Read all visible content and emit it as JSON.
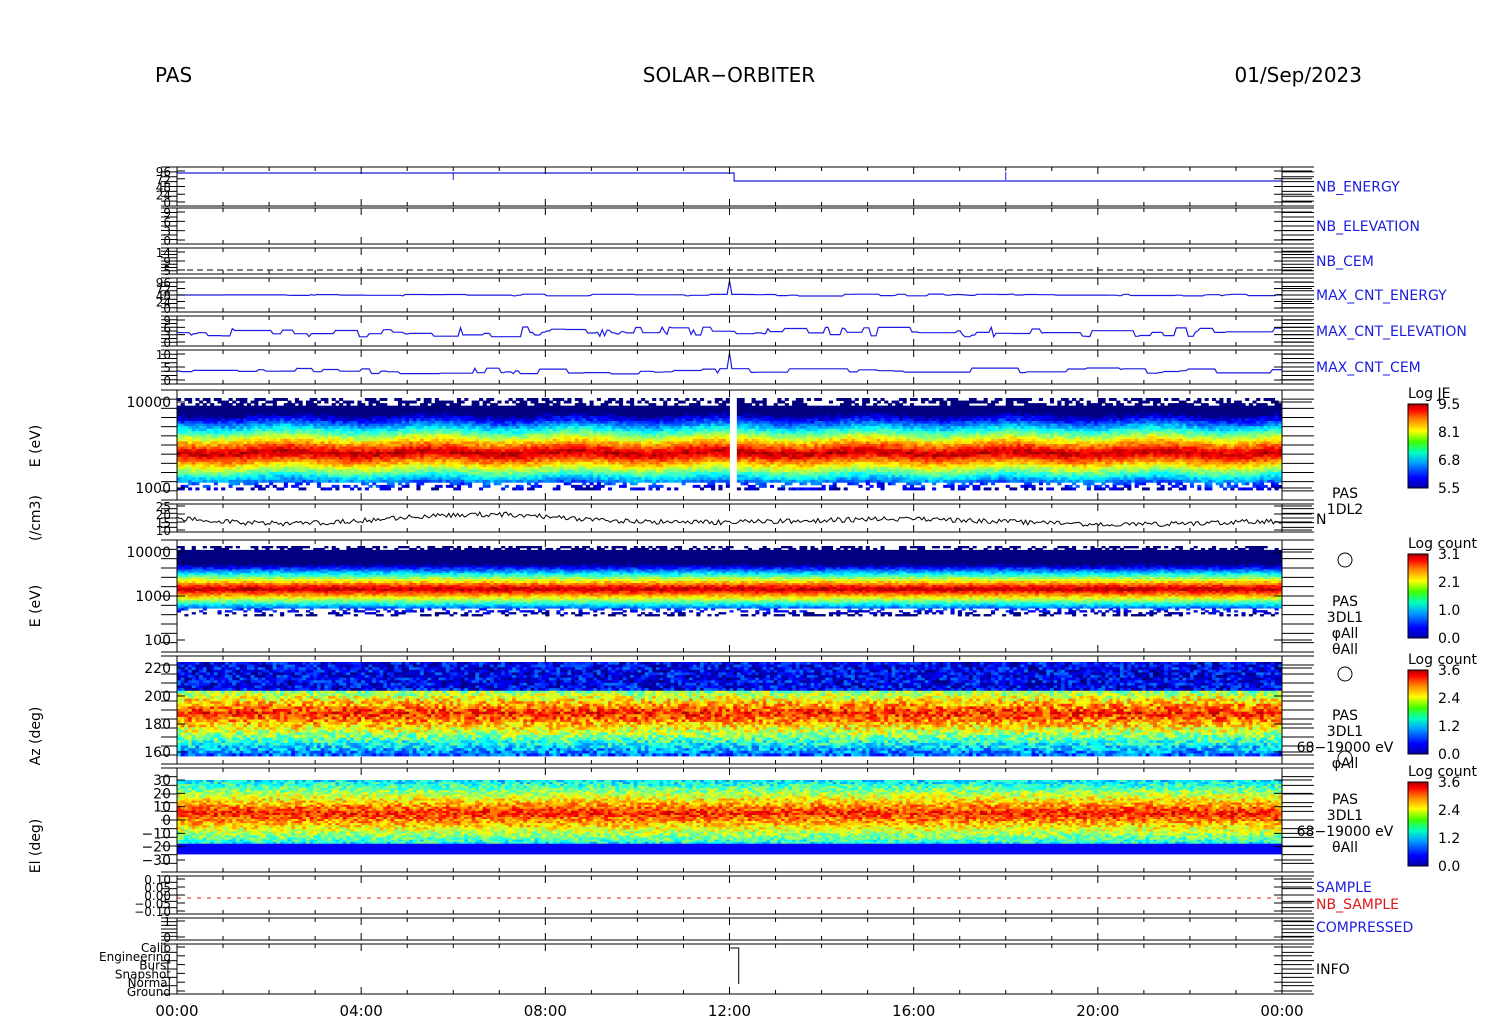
{
  "header": {
    "left": "PAS",
    "center": "SOLAR−ORBITER",
    "right": "01/Sep/2023"
  },
  "colors": {
    "blue": "#1c1ce0",
    "red": "#e01818",
    "black": "#000000"
  },
  "chart_data": {
    "type": "heatmap",
    "x": {
      "ticks": [
        "00:00",
        "04:00",
        "08:00",
        "12:00",
        "16:00",
        "20:00",
        "00:00"
      ],
      "range_hours": [
        0,
        24
      ]
    },
    "panels": [
      {
        "id": "nb_energy",
        "type": "line",
        "label": "NB_ENERGY",
        "ytick_labels": [
          "96",
          "72",
          "48",
          "24",
          "0"
        ]
      },
      {
        "id": "nb_elevation",
        "type": "line",
        "label": "NB_ELEVATION",
        "ytick_labels": [
          "9",
          "6",
          "3",
          "0"
        ]
      },
      {
        "id": "nb_cem",
        "type": "line",
        "label": "NB_CEM",
        "ytick_labels": [
          "14",
          "9",
          "5"
        ]
      },
      {
        "id": "max_cnt_energy",
        "type": "line",
        "label": "MAX_CNT_ENERGY",
        "ytick_labels": [
          "96",
          "72",
          "48",
          "24",
          "0"
        ]
      },
      {
        "id": "max_cnt_elevation",
        "type": "line",
        "label": "MAX_CNT_ELEVATION",
        "ytick_labels": [
          "9",
          "6",
          "3",
          "0"
        ]
      },
      {
        "id": "max_cnt_cem",
        "type": "line",
        "label": "MAX_CNT_CEM",
        "ytick_labels": [
          "10",
          "5",
          "0"
        ]
      },
      {
        "id": "pas_1dl2_spec",
        "type": "heatmap",
        "ylabel": "E (eV)",
        "yscale": "log",
        "ytick_labels": [
          "10000",
          "1000"
        ],
        "colorbar": {
          "title": "Log JE",
          "ticks": [
            "9.5",
            "8.1",
            "6.8",
            "5.5"
          ]
        }
      },
      {
        "id": "pas_density",
        "type": "line",
        "ylabel": "(/cm3)",
        "ytick_labels": [
          "25",
          "20",
          "15",
          "10"
        ],
        "label_lines": [
          "PAS",
          "1DL2"
        ],
        "series": "N"
      },
      {
        "id": "pas_3dl1_energy",
        "type": "heatmap",
        "ylabel": "E (eV)",
        "yscale": "log",
        "ytick_labels": [
          "10000",
          "1000",
          "100"
        ],
        "side_labels": [
          "PAS",
          "3DL1",
          "φAll",
          "θAll"
        ],
        "colorbar": {
          "title": "Log count",
          "ticks": [
            "3.1",
            "2.1",
            "1.0",
            "0.0"
          ]
        }
      },
      {
        "id": "pas_3dl1_azimuth",
        "type": "heatmap",
        "ylabel": "Az (deg)",
        "ytick_labels": [
          "220",
          "200",
          "180",
          "160"
        ],
        "side_labels": [
          "PAS",
          "3DL1",
          "68−19000 eV",
          "φAll"
        ],
        "colorbar": {
          "title": "Log count",
          "ticks": [
            "3.6",
            "2.4",
            "1.2",
            "0.0"
          ]
        }
      },
      {
        "id": "pas_3dl1_elevation",
        "type": "heatmap",
        "ylabel": "El (deg)",
        "ytick_labels": [
          "30",
          "20",
          "10",
          "0",
          "−10",
          "−20",
          "−30"
        ],
        "side_labels": [
          "PAS",
          "3DL1",
          "68−19000 eV",
          "θAll"
        ],
        "colorbar": {
          "title": "Log count",
          "ticks": [
            "3.6",
            "2.4",
            "1.2",
            "0.0"
          ]
        }
      },
      {
        "id": "sample",
        "type": "line",
        "labels": [
          "SAMPLE",
          "NB_SAMPLE"
        ],
        "ytick_labels": [
          "0.10",
          "0.05",
          "0.00",
          "−0.05",
          "−0.10"
        ]
      },
      {
        "id": "compressed",
        "type": "line",
        "label": "COMPRESSED",
        "ytick_labels": [
          "1",
          "0"
        ]
      },
      {
        "id": "info",
        "type": "line",
        "label": "INFO",
        "ytick_labels": [
          "Calib",
          "Engineering",
          "Burst",
          "Snapshot",
          "Normal",
          "Ground"
        ]
      }
    ]
  }
}
